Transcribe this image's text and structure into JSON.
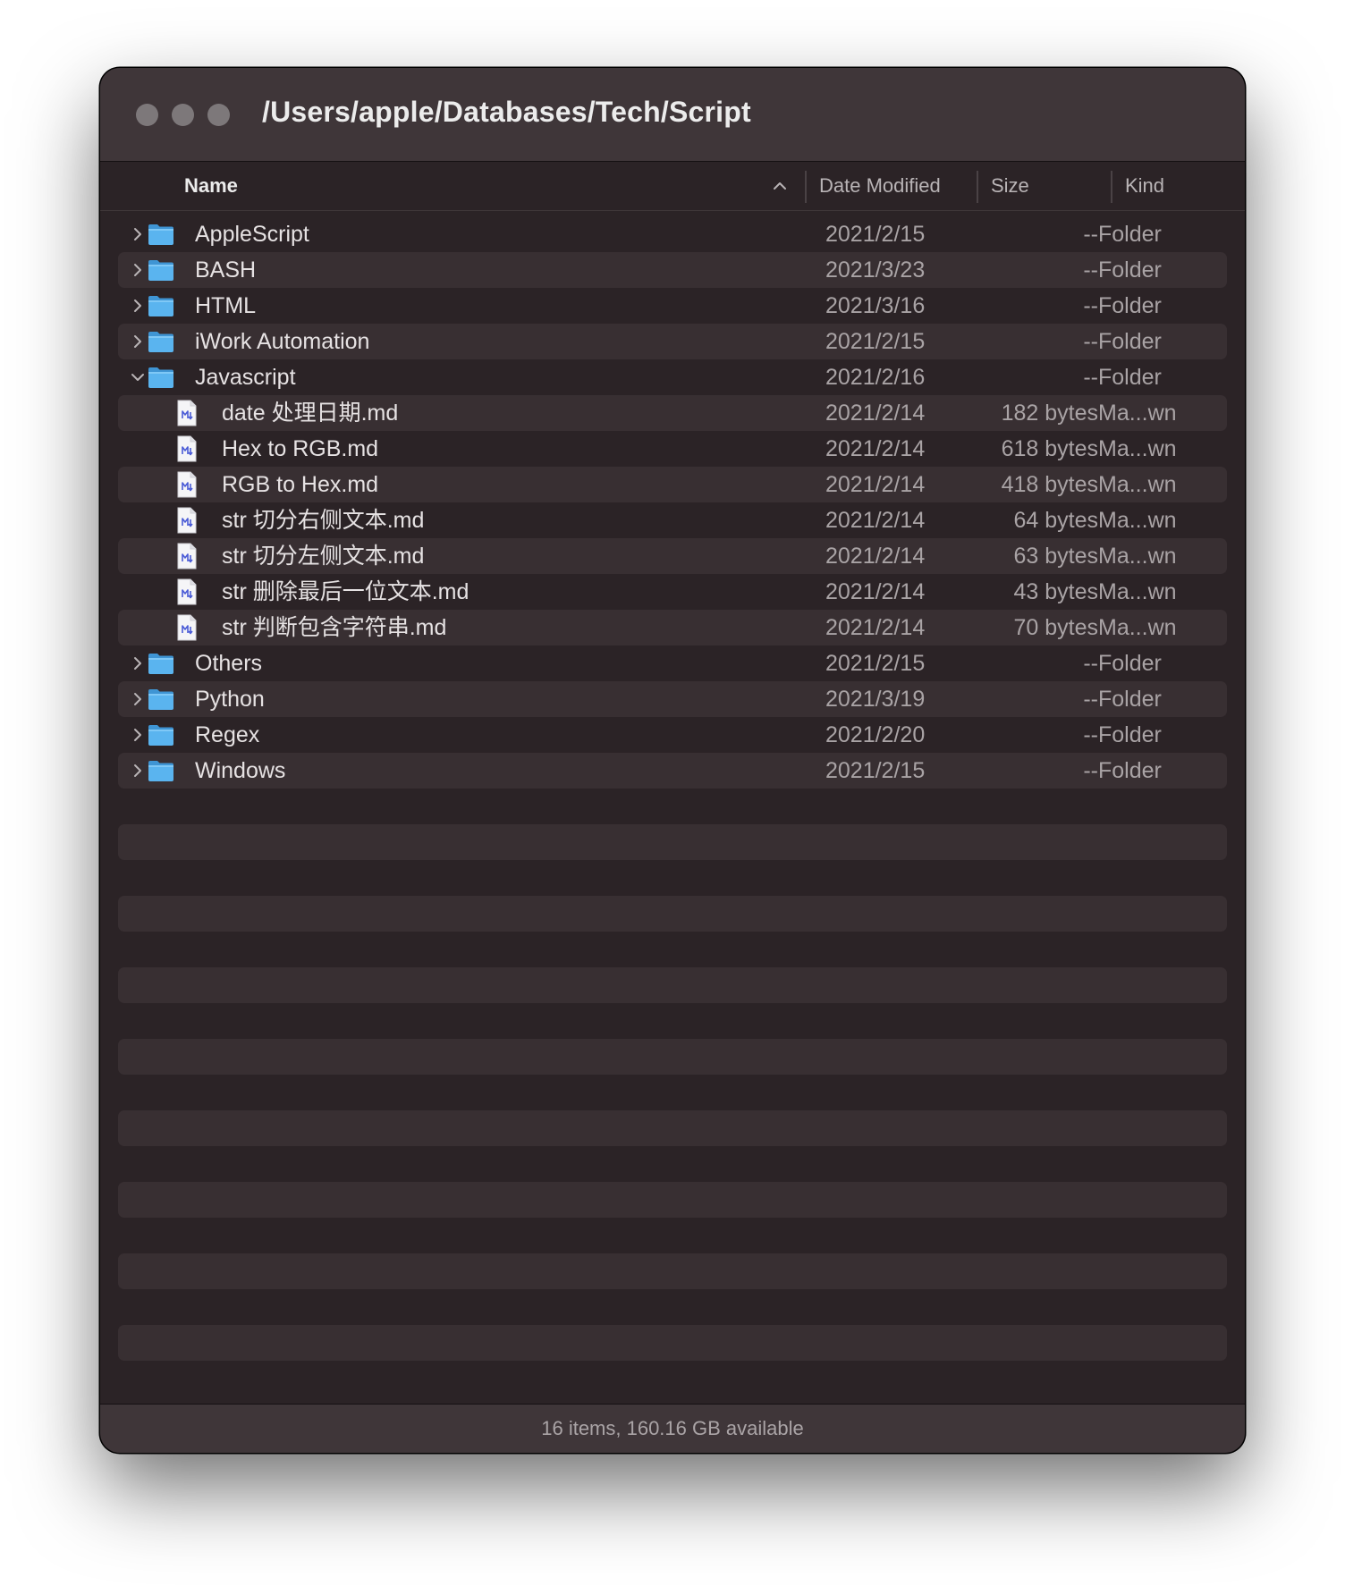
{
  "window": {
    "title": "/Users/apple/Databases/Tech/Script"
  },
  "columns": {
    "name": "Name",
    "date": "Date Modified",
    "size": "Size",
    "kind": "Kind"
  },
  "rows": [
    {
      "name": "AppleScript",
      "date": "2021/2/15",
      "size": "--",
      "kind": "Folder",
      "type": "folder",
      "expanded": false,
      "depth": 0
    },
    {
      "name": "BASH",
      "date": "2021/3/23",
      "size": "--",
      "kind": "Folder",
      "type": "folder",
      "expanded": false,
      "depth": 0
    },
    {
      "name": "HTML",
      "date": "2021/3/16",
      "size": "--",
      "kind": "Folder",
      "type": "folder",
      "expanded": false,
      "depth": 0
    },
    {
      "name": "iWork Automation",
      "date": "2021/2/15",
      "size": "--",
      "kind": "Folder",
      "type": "folder",
      "expanded": false,
      "depth": 0
    },
    {
      "name": "Javascript",
      "date": "2021/2/16",
      "size": "--",
      "kind": "Folder",
      "type": "folder",
      "expanded": true,
      "depth": 0
    },
    {
      "name": "date 处理日期.md",
      "date": "2021/2/14",
      "size": "182 bytes",
      "kind": "Ma...wn",
      "type": "file",
      "depth": 1
    },
    {
      "name": "Hex to RGB.md",
      "date": "2021/2/14",
      "size": "618 bytes",
      "kind": "Ma...wn",
      "type": "file",
      "depth": 1
    },
    {
      "name": "RGB to Hex.md",
      "date": "2021/2/14",
      "size": "418 bytes",
      "kind": "Ma...wn",
      "type": "file",
      "depth": 1
    },
    {
      "name": "str 切分右侧文本.md",
      "date": "2021/2/14",
      "size": "64 bytes",
      "kind": "Ma...wn",
      "type": "file",
      "depth": 1
    },
    {
      "name": "str 切分左侧文本.md",
      "date": "2021/2/14",
      "size": "63 bytes",
      "kind": "Ma...wn",
      "type": "file",
      "depth": 1
    },
    {
      "name": "str 删除最后一位文本.md",
      "date": "2021/2/14",
      "size": "43 bytes",
      "kind": "Ma...wn",
      "type": "file",
      "depth": 1
    },
    {
      "name": "str 判断包含字符串.md",
      "date": "2021/2/14",
      "size": "70 bytes",
      "kind": "Ma...wn",
      "type": "file",
      "depth": 1
    },
    {
      "name": "Others",
      "date": "2021/2/15",
      "size": "--",
      "kind": "Folder",
      "type": "folder",
      "expanded": false,
      "depth": 0
    },
    {
      "name": "Python",
      "date": "2021/3/19",
      "size": "--",
      "kind": "Folder",
      "type": "folder",
      "expanded": false,
      "depth": 0
    },
    {
      "name": "Regex",
      "date": "2021/2/20",
      "size": "--",
      "kind": "Folder",
      "type": "folder",
      "expanded": false,
      "depth": 0
    },
    {
      "name": "Windows",
      "date": "2021/2/15",
      "size": "--",
      "kind": "Folder",
      "type": "folder",
      "expanded": false,
      "depth": 0
    }
  ],
  "status": {
    "text": "16 items, 160.16 GB available"
  },
  "colors": {
    "folder": "#5ab4ef",
    "window_bg": "#2b2326",
    "alt_row": "#382f32",
    "titlebar": "#3f3639"
  },
  "icons": {
    "folder": "folder-icon",
    "file": "markdown-file-icon",
    "collapsed": "chevron-right-icon",
    "expanded": "chevron-down-icon",
    "sort": "chevron-up-icon"
  }
}
